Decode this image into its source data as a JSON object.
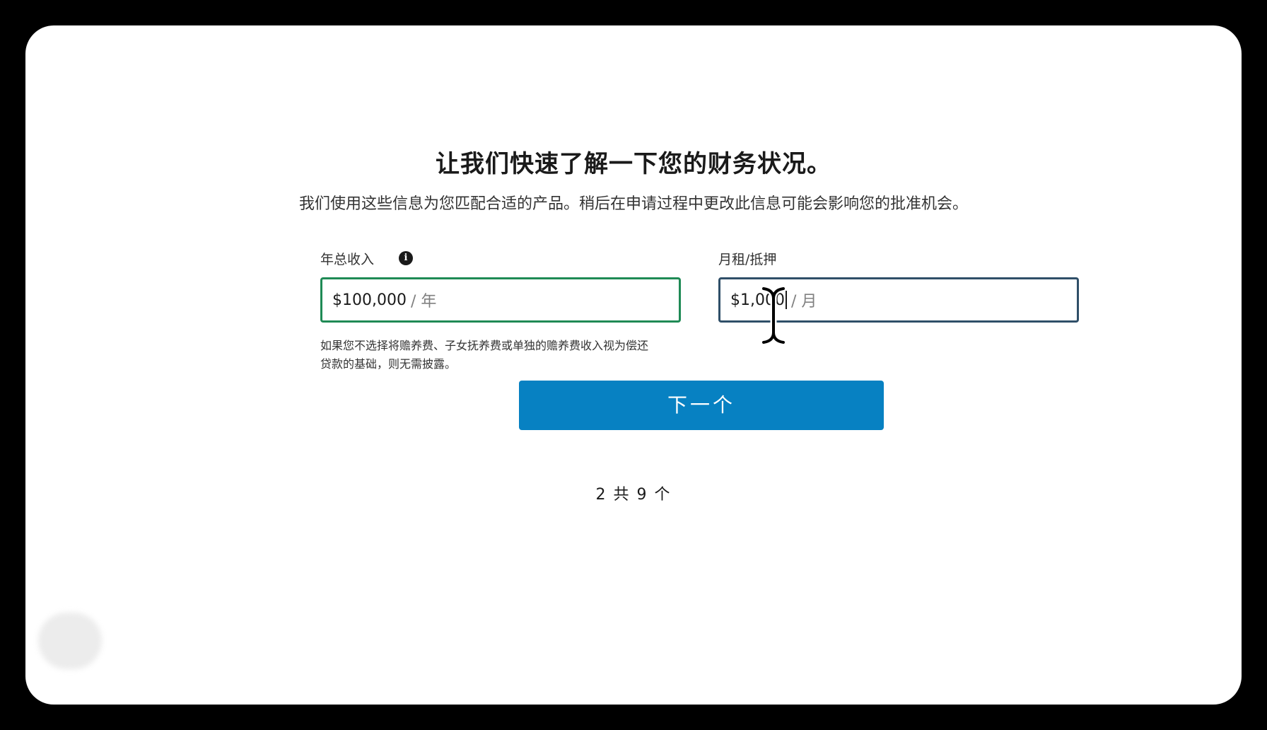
{
  "page": {
    "title": "让我们快速了解一下您的财务状况。",
    "subtitle": "我们使用这些信息为您匹配合适的产品。稍后在申请过程中更改此信息可能会影响您的批准机会。"
  },
  "income": {
    "label": "年总收入",
    "info_icon": "info-icon",
    "value": "$100,000",
    "suffix": "/ 年",
    "helper_line1": "如果您不选择将赡养费、子女抚养费或单独的赡养费收入视为偿还",
    "helper_line2": "贷款的基础，则无需披露。"
  },
  "housing": {
    "label": "月租/抵押",
    "value": "$1,000",
    "suffix": "/ 月"
  },
  "actions": {
    "next_label": "下一个"
  },
  "progress": {
    "step_text": "2 共 9 个"
  },
  "colors": {
    "primary_button": "#0781c2",
    "income_border": "#1f8a55",
    "housing_border": "#2f4f68"
  }
}
